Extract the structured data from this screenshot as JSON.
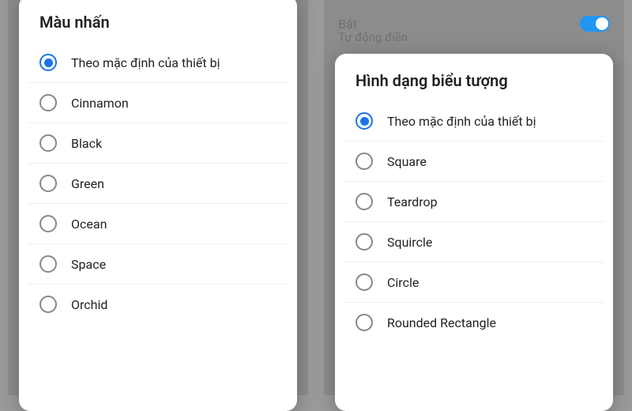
{
  "left": {
    "title": "Màu nhấn",
    "options": [
      {
        "label": "Theo mặc định của thiết bị",
        "selected": true
      },
      {
        "label": "Cinnamon",
        "selected": false
      },
      {
        "label": "Black",
        "selected": false
      },
      {
        "label": "Green",
        "selected": false
      },
      {
        "label": "Ocean",
        "selected": false
      },
      {
        "label": "Space",
        "selected": false
      },
      {
        "label": "Orchid",
        "selected": false
      }
    ]
  },
  "right": {
    "bg_toggle_label": "Bật",
    "bg_subtext": "Tự động điền",
    "title": "Hình dạng biểu tượng",
    "options": [
      {
        "label": "Theo mặc định của thiết bị",
        "selected": true
      },
      {
        "label": "Square",
        "selected": false
      },
      {
        "label": "Teardrop",
        "selected": false
      },
      {
        "label": "Squircle",
        "selected": false
      },
      {
        "label": "Circle",
        "selected": false
      },
      {
        "label": "Rounded Rectangle",
        "selected": false
      }
    ]
  }
}
